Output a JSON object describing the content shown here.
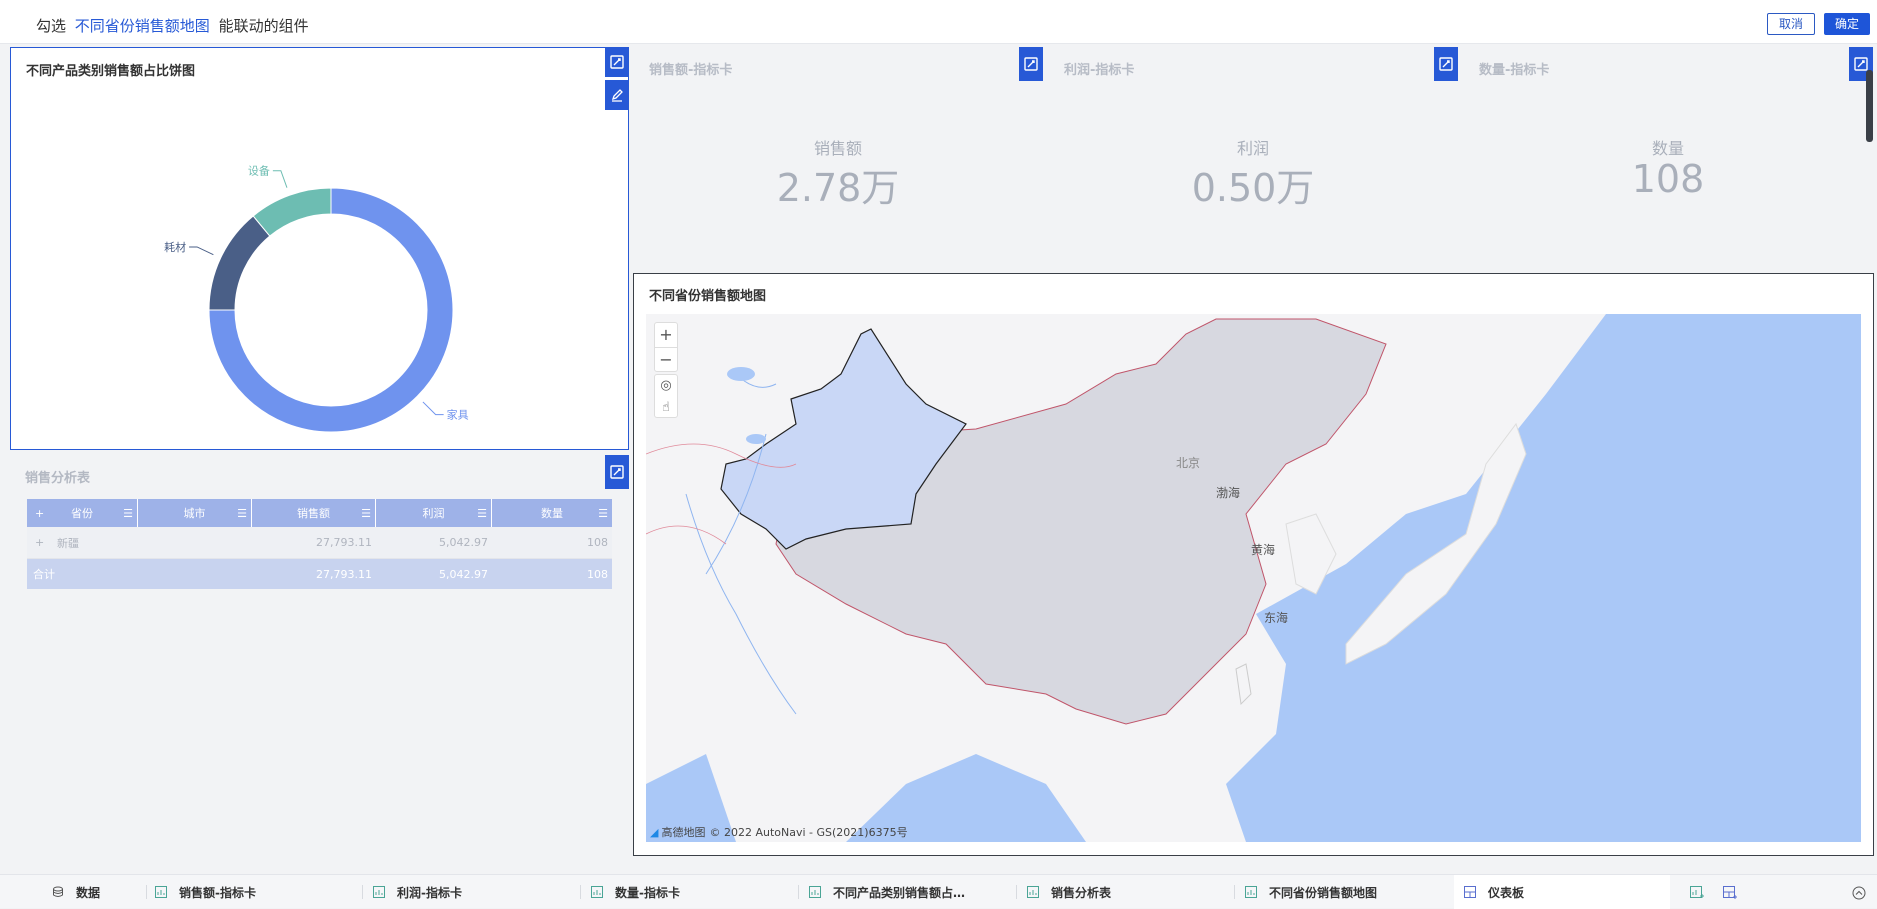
{
  "header": {
    "prefix": "勾选",
    "target": "不同省份销售额地图",
    "suffix": "能联动的组件",
    "cancel_label": "取消",
    "ok_label": "确定"
  },
  "pie_panel": {
    "title": "不同产品类别销售额占比饼图"
  },
  "chart_data": {
    "type": "pie",
    "donut": true,
    "categories": [
      "家具",
      "耗材",
      "设备"
    ],
    "values": [
      0.75,
      0.14,
      0.11
    ],
    "colors": [
      "#6f93ee",
      "#4a5f87",
      "#6dbdb2"
    ]
  },
  "kpis": [
    {
      "title": "销售额-指标卡",
      "label": "销售额",
      "value": "2.78万"
    },
    {
      "title": "利润-指标卡",
      "label": "利润",
      "value": "0.50万"
    },
    {
      "title": "数量-指标卡",
      "label": "数量",
      "value": "108"
    }
  ],
  "table": {
    "title": "销售分析表",
    "columns": [
      "省份",
      "城市",
      "销售额",
      "利润",
      "数量"
    ],
    "rows": [
      {
        "expand": "+",
        "province": "新疆",
        "city": "",
        "sales": "27,793.11",
        "profit": "5,042.97",
        "qty": "108"
      }
    ],
    "total": {
      "label": "合计",
      "sales": "27,793.11",
      "profit": "5,042.97",
      "qty": "108"
    },
    "head_expand": "+"
  },
  "map_panel": {
    "title": "不同省份销售额地图",
    "zoom_in": "+",
    "zoom_out": "−",
    "labels": {
      "beijing": "北京",
      "bohai": "渤海",
      "huanghai": "黄海",
      "donghai": "东海"
    },
    "attribution_brand": "高德地图",
    "attribution": "© 2022 AutoNavi - GS(2021)6375号"
  },
  "bottom_tabs": [
    {
      "label": "数据",
      "icon": "database-icon"
    },
    {
      "label": "销售额-指标卡",
      "icon": "chart-icon"
    },
    {
      "label": "利润-指标卡",
      "icon": "chart-icon"
    },
    {
      "label": "数量-指标卡",
      "icon": "chart-icon"
    },
    {
      "label": "不同产品类别销售额占…",
      "icon": "chart-icon"
    },
    {
      "label": "销售分析表",
      "icon": "chart-icon"
    },
    {
      "label": "不同省份销售额地图",
      "icon": "chart-icon"
    },
    {
      "label": "仪表板",
      "icon": "dashboard-icon"
    }
  ],
  "colors": {
    "accent": "#2759d6",
    "donut_main": "#6f93ee",
    "donut_dark": "#4a5f87",
    "donut_teal": "#6dbdb2",
    "sea": "#aac8f7",
    "land_selected": "#c9d7f6",
    "land_china": "#d7d8e0"
  }
}
